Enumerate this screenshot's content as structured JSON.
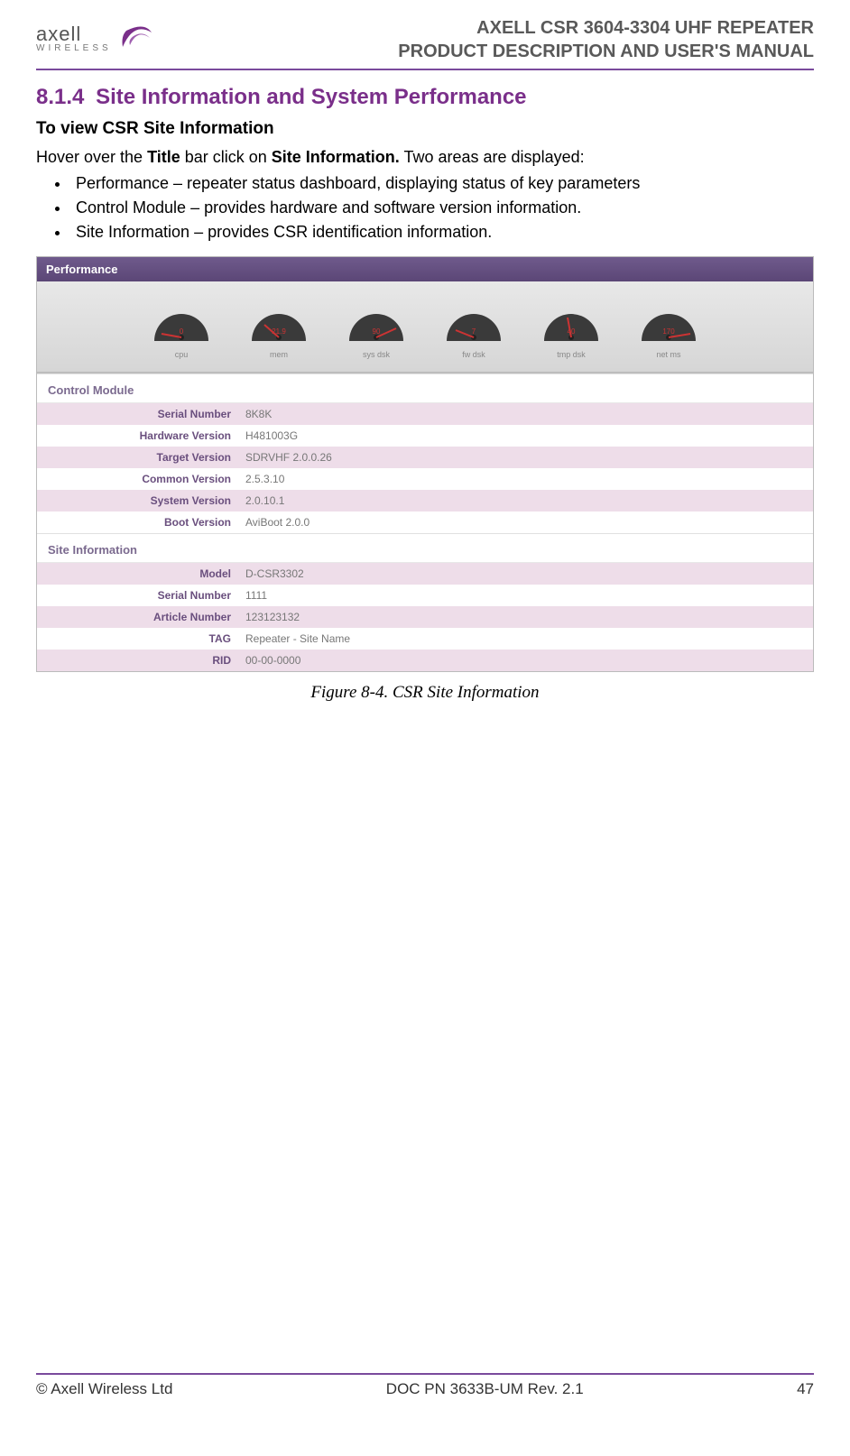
{
  "header": {
    "brand_main": "axell",
    "brand_sub": "WIRELESS",
    "title_line1": "AXELL CSR 3604-3304 UHF REPEATER",
    "title_line2": "PRODUCT DESCRIPTION AND USER'S MANUAL"
  },
  "section": {
    "number": "8.1.4",
    "title": "Site Information and System Performance"
  },
  "subhead": "To view CSR Site Information",
  "intro_prefix": "Hover over the ",
  "intro_bold1": "Title",
  "intro_mid": " bar click on ",
  "intro_bold2": "Site Information.",
  "intro_suffix": " Two areas are displayed:",
  "bullets": [
    "Performance – repeater status dashboard, displaying status of key parameters",
    "Control Module – provides hardware and software version information.",
    "Site Information – provides CSR identification information."
  ],
  "screenshot": {
    "performance_title": "Performance",
    "gauges": [
      {
        "label": "cpu",
        "value": "0"
      },
      {
        "label": "mem",
        "value": "21.9"
      },
      {
        "label": "sys dsk",
        "value": "90"
      },
      {
        "label": "fw dsk",
        "value": "7"
      },
      {
        "label": "tmp dsk",
        "value": "40"
      },
      {
        "label": "net ms",
        "value": "170"
      }
    ],
    "control_module_title": "Control Module",
    "control_module": [
      {
        "label": "Serial Number",
        "value": "8K8K"
      },
      {
        "label": "Hardware Version",
        "value": "H481003G"
      },
      {
        "label": "Target Version",
        "value": "SDRVHF 2.0.0.26"
      },
      {
        "label": "Common Version",
        "value": "2.5.3.10"
      },
      {
        "label": "System Version",
        "value": "2.0.10.1"
      },
      {
        "label": "Boot Version",
        "value": "AviBoot 2.0.0"
      }
    ],
    "site_info_title": "Site Information",
    "site_info": [
      {
        "label": "Model",
        "value": "D-CSR3302"
      },
      {
        "label": "Serial Number",
        "value": "1111"
      },
      {
        "label": "Article Number",
        "value": "123123132"
      },
      {
        "label": "TAG",
        "value": "Repeater - Site Name"
      },
      {
        "label": "RID",
        "value": "00-00-0000"
      }
    ]
  },
  "figure_caption": "Figure 8-4. CSR Site Information",
  "footer": {
    "left": "© Axell Wireless Ltd",
    "center": "DOC PN 3633B-UM Rev. 2.1",
    "right": "47"
  }
}
